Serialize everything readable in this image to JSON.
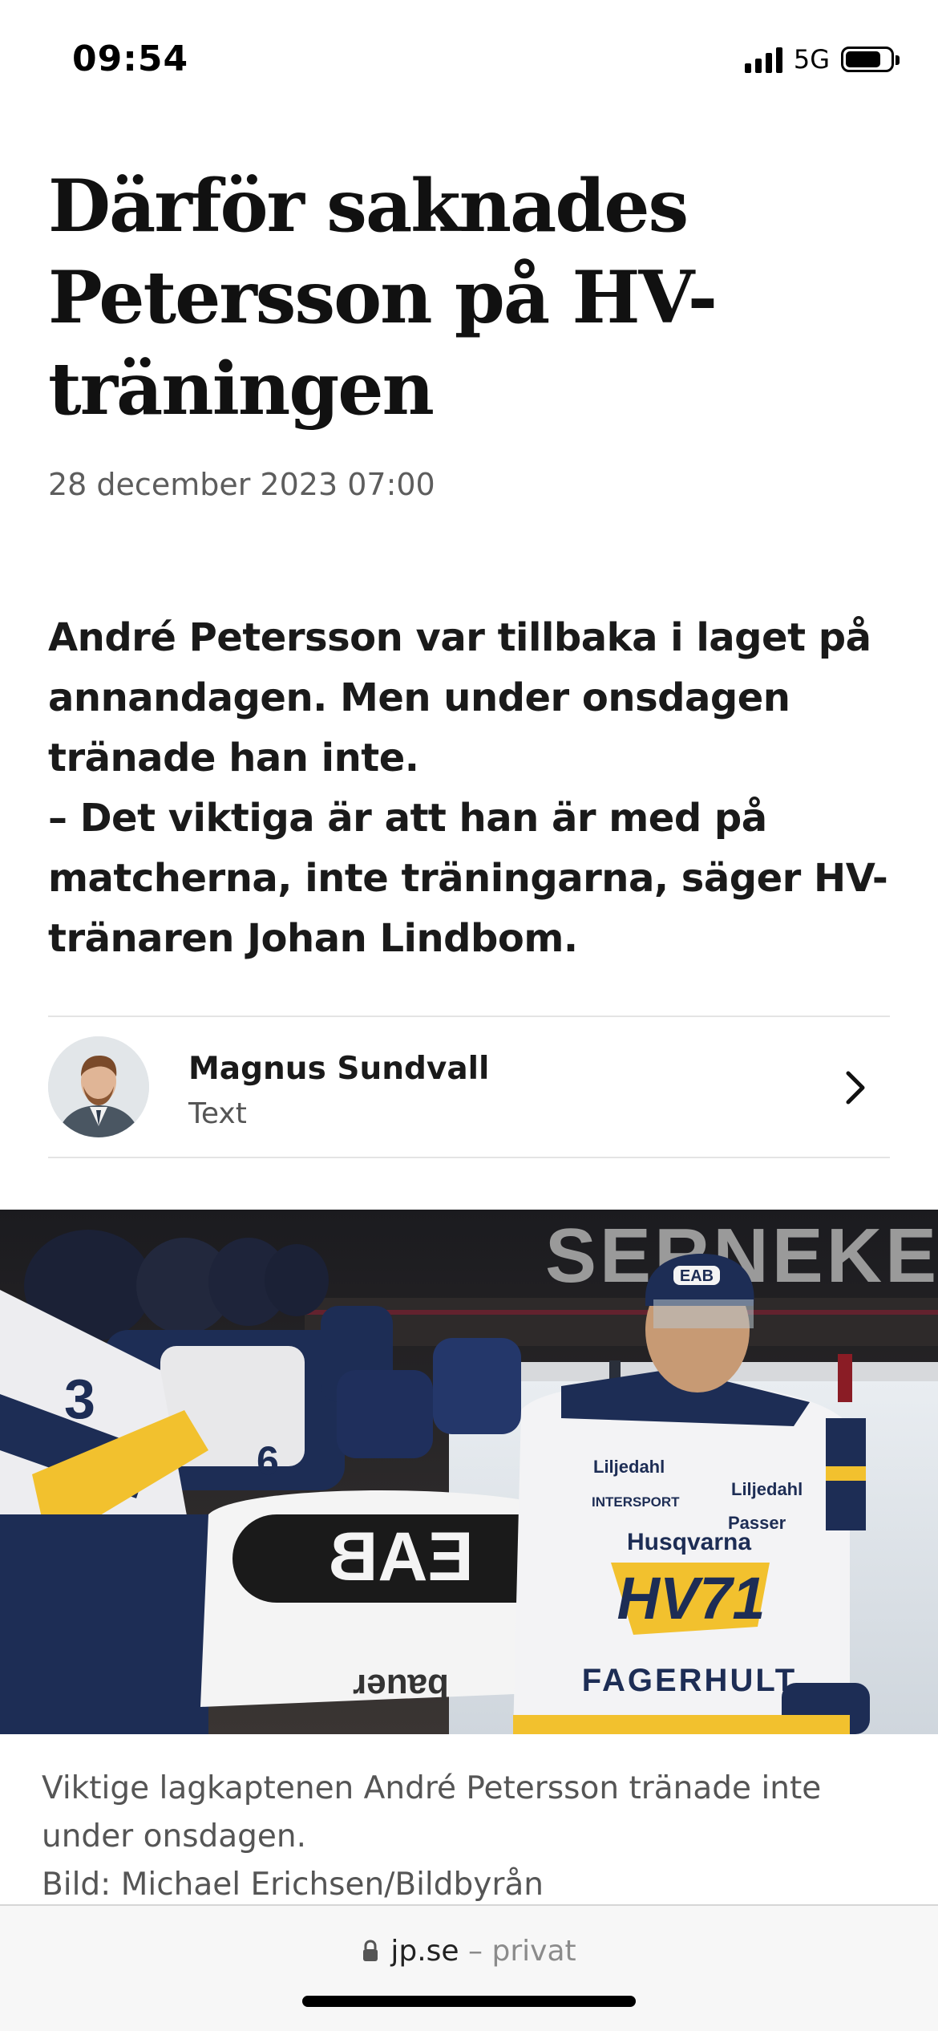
{
  "status": {
    "time": "09:54",
    "network": "5G",
    "battery_level": 0.8
  },
  "article": {
    "headline": "Därför saknades Petersson på HV-träningen",
    "date": "28 december 2023 07:00",
    "lead_lines": [
      "André Petersson var tillbaka i laget på annandagen. Men under onsdagen tränade han inte.",
      "– Det viktiga är att han är med på matcherna, inte träningarna, säger HV-tränaren Johan Lindbom."
    ]
  },
  "author": {
    "name": "Magnus Sundvall",
    "role": "Text"
  },
  "photo": {
    "caption_line1": "Viktige lagkaptenen André Petersson tränade inte under onsdagen.",
    "credit": "Bild: Michael Erichsen/Bildbyrån",
    "arena_sign": "SERNEKE",
    "jersey_brand": "FAGERHULT",
    "sponsors": [
      "Liljedahl",
      "INTERSPORT",
      "Husqvarna",
      "Passer"
    ],
    "team_logo": "HV71",
    "helmet_logo": "EAB",
    "glove_brand": "bauer"
  },
  "browser": {
    "domain": "jp.se",
    "separator": "–",
    "mode": "privat"
  },
  "colors": {
    "text": "#161616",
    "muted": "#5d5d5d",
    "team_navy": "#1d2d55",
    "team_yellow": "#f2c12e"
  }
}
